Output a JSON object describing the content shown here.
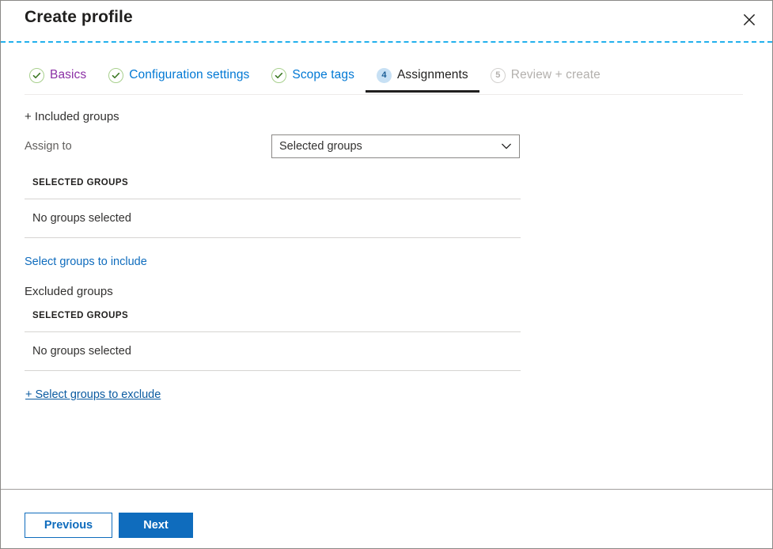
{
  "window": {
    "title": "Create profile",
    "close_icon": "close-icon"
  },
  "wizard": {
    "tabs": [
      {
        "label": "Basics",
        "marker": "check-icon",
        "state": "completed-visited"
      },
      {
        "label": "Configuration settings",
        "marker": "check-icon",
        "state": "completed"
      },
      {
        "label": "Scope tags",
        "marker": "check-icon",
        "state": "completed"
      },
      {
        "label": "Assignments",
        "marker": "4",
        "state": "active"
      },
      {
        "label": "Review + create",
        "marker": "5",
        "state": "disabled"
      }
    ]
  },
  "form": {
    "included_heading": "+ Included groups",
    "assign_to_label": "Assign to",
    "assign_to_value": "Selected groups",
    "assign_to_chevron_icon": "chevron-down-icon",
    "included_table": {
      "header": "SELECTED GROUPS",
      "empty_text": "No groups selected"
    },
    "include_link": "Select groups to include",
    "excluded_heading": "Excluded groups",
    "excluded_table": {
      "header": "SELECTED GROUPS",
      "empty_text": "No groups selected"
    },
    "exclude_link": "+ Select groups to exclude"
  },
  "footer": {
    "previous_label": "Previous",
    "next_label": "Next"
  },
  "colors": {
    "accent": "#0f6cbd",
    "link": "#0f6cbd",
    "visited_link": "#8b2fa5",
    "active_tab_underline": "#201f1e",
    "active_step_badge": "#c7e0f4",
    "check_green": "#3b7722",
    "dashed_rule": "#22b0ec",
    "disabled_text": "#b3b0ad"
  }
}
